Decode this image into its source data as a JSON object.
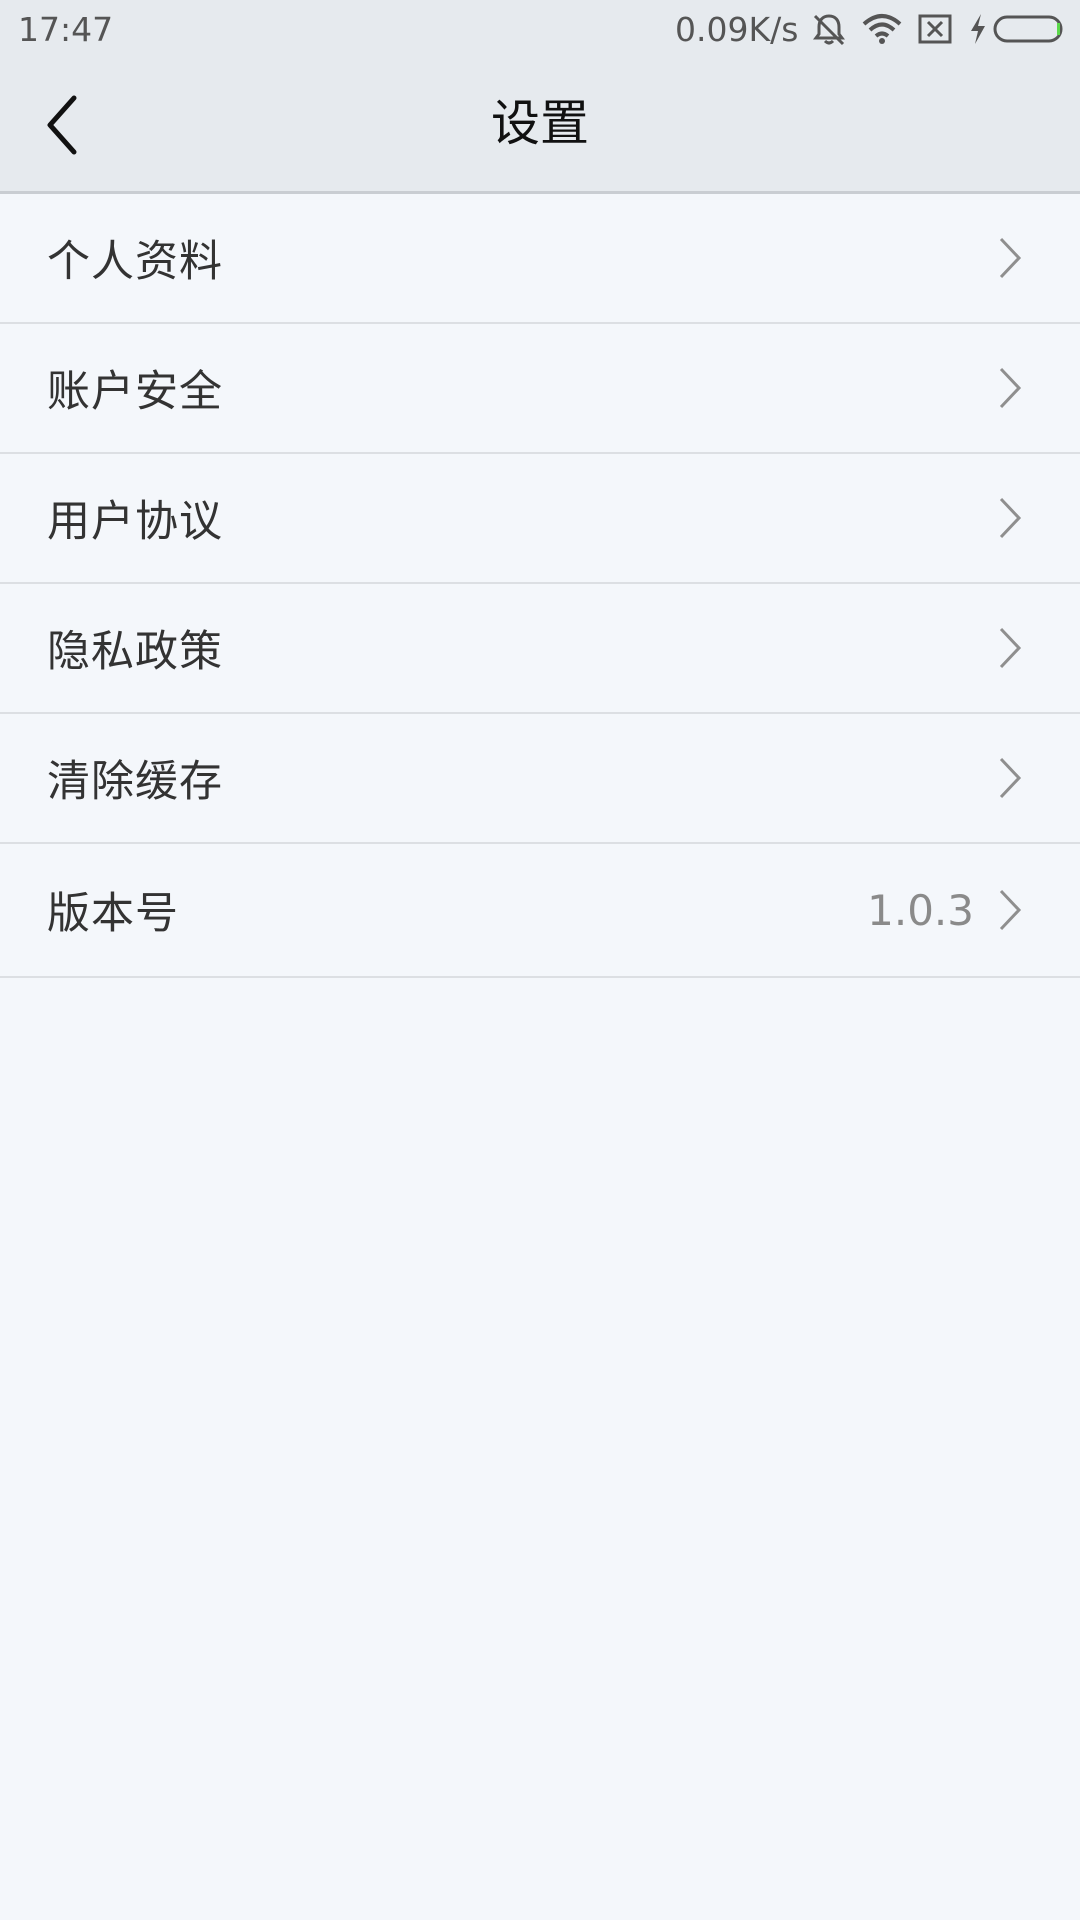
{
  "status_bar": {
    "time": "17:47",
    "net_speed": "0.09K/s",
    "icons": [
      "mute-icon",
      "wifi-icon",
      "sim-card-none-icon",
      "charging-bolt-icon",
      "battery-icon"
    ]
  },
  "header": {
    "title": "设置",
    "back_icon": "chevron-left-icon"
  },
  "settings": {
    "items": [
      {
        "label": "个人资料",
        "value": ""
      },
      {
        "label": "账户安全",
        "value": ""
      },
      {
        "label": "用户协议",
        "value": ""
      },
      {
        "label": "隐私政策",
        "value": ""
      },
      {
        "label": "清除缓存",
        "value": ""
      },
      {
        "label": "版本号",
        "value": "1.0.3"
      }
    ]
  },
  "colors": {
    "background": "#f4f7fb",
    "header_bg": "#e6eaee",
    "divider": "#dcdfe3",
    "battery_accent": "#5bd94a"
  }
}
